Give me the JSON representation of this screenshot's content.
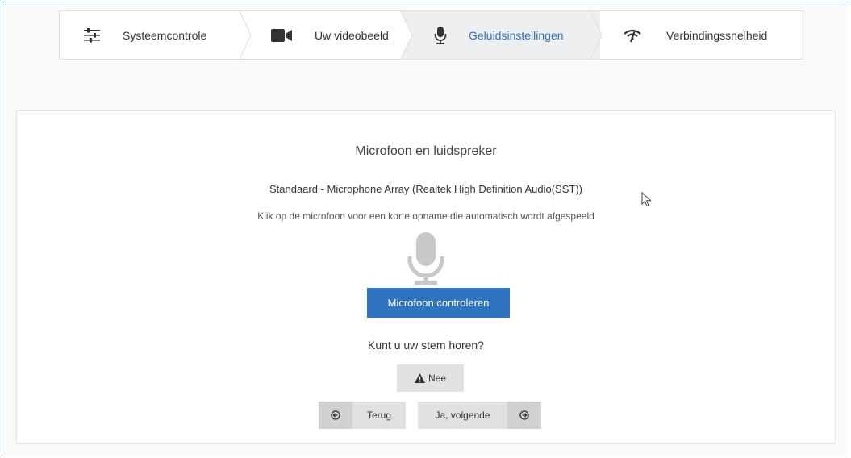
{
  "stepper": {
    "steps": [
      {
        "label": "Systeemcontrole",
        "icon": "sliders-icon",
        "active": false
      },
      {
        "label": "Uw videobeeld",
        "icon": "video-camera-icon",
        "active": false
      },
      {
        "label": "Geluidsinstellingen",
        "icon": "microphone-icon",
        "active": true
      },
      {
        "label": "Verbindingssnelheid",
        "icon": "signal-icon",
        "active": false
      }
    ]
  },
  "main": {
    "title": "Microfoon en luidspreker",
    "device": "Standaard - Microphone Array (Realtek High Definition Audio(SST))",
    "hint": "Klik op de microfoon voor een korte opname die automatisch wordt afgespeeld",
    "check_button": "Microfoon controleren",
    "question": "Kunt u uw stem horen?",
    "no_button": "Nee",
    "back_button": "Terug",
    "next_button": "Ja, volgende"
  },
  "colors": {
    "accent": "#2e74c0",
    "active_step_bg": "#eeeff1",
    "button_gray": "#e1e1e1"
  }
}
